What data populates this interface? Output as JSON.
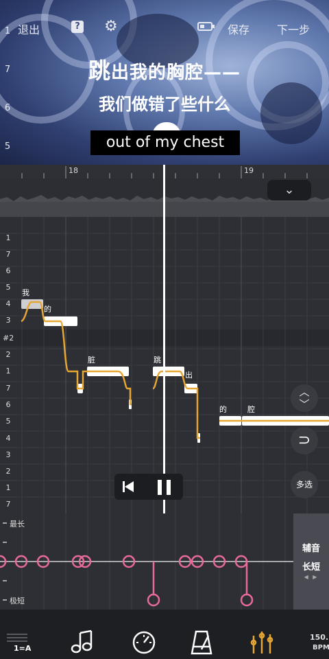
{
  "header": {
    "exit_label": "退出",
    "save_label": "保存",
    "next_label": "下一步",
    "help_glyph": "?"
  },
  "video": {
    "scale_labels": [
      "1",
      "7",
      "6",
      "5"
    ],
    "lyric_line1_lead": "跳",
    "lyric_line1_rest": "出我的胸腔——",
    "lyric_line2": "我们做错了些什么",
    "subtitle": "out of my chest"
  },
  "timeline": {
    "bar_labels": [
      "18",
      "19"
    ]
  },
  "roll": {
    "pitch_labels": [
      "1",
      "7",
      "6",
      "5",
      "4",
      "3",
      "#2",
      "2",
      "1",
      "7",
      "6",
      "5",
      "4",
      "3",
      "2",
      "1",
      "7"
    ],
    "lyrics": [
      "我",
      "的",
      "脏",
      "跳",
      "出",
      "的",
      "腔"
    ],
    "note_color": "#ffffff",
    "pitch_curve_color": "#e6a634",
    "multiselect_label": "多选"
  },
  "duration": {
    "max_label": "最长",
    "min_label": "极短",
    "node_color": "#e86a9a"
  },
  "aux": {
    "title": "辅音",
    "subtitle": "长短",
    "arrows": "◀ ▶"
  },
  "toolbar": {
    "key_label": "1=A",
    "bpm_value": "150.",
    "bpm_unit": "BPM",
    "accent": "#e6a634"
  }
}
